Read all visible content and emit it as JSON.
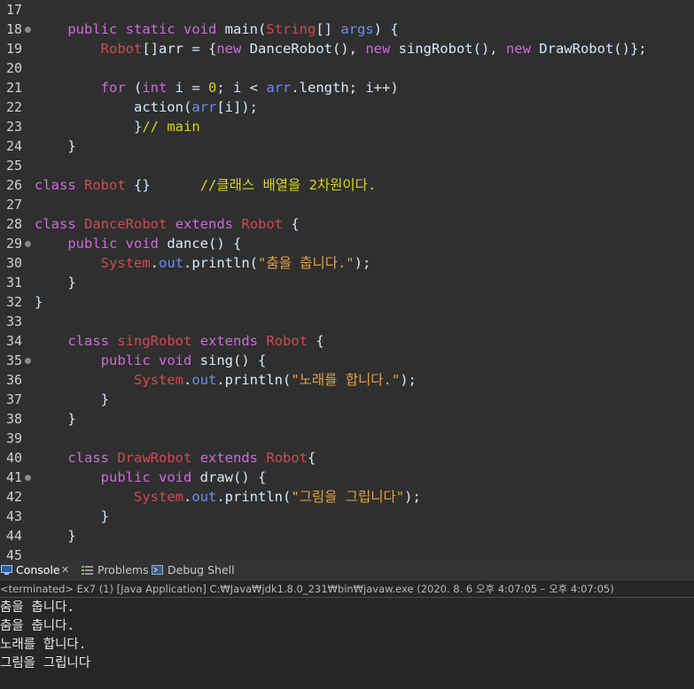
{
  "editor": {
    "lines": [
      {
        "num": "17",
        "fold": false,
        "tokens": []
      },
      {
        "num": "18",
        "fold": true,
        "tokens": [
          [
            "d",
            "    "
          ],
          [
            "k",
            "public"
          ],
          [
            "d",
            " "
          ],
          [
            "k",
            "static"
          ],
          [
            "d",
            " "
          ],
          [
            "k",
            "void"
          ],
          [
            "d",
            " main("
          ],
          [
            "t",
            "String"
          ],
          [
            "d",
            "[] "
          ],
          [
            "n",
            "args"
          ],
          [
            "d",
            ") {"
          ]
        ]
      },
      {
        "num": "19",
        "fold": false,
        "tokens": [
          [
            "d",
            "        "
          ],
          [
            "t",
            "Robot"
          ],
          [
            "d",
            "[]arr = {"
          ],
          [
            "k",
            "new"
          ],
          [
            "d",
            " DanceRobot(), "
          ],
          [
            "k",
            "new"
          ],
          [
            "d",
            " singRobot(), "
          ],
          [
            "k",
            "new"
          ],
          [
            "d",
            " DrawRobot()};"
          ]
        ]
      },
      {
        "num": "20",
        "fold": false,
        "tokens": []
      },
      {
        "num": "21",
        "fold": false,
        "tokens": [
          [
            "d",
            "        "
          ],
          [
            "k",
            "for"
          ],
          [
            "d",
            " ("
          ],
          [
            "k",
            "int"
          ],
          [
            "d",
            " i = "
          ],
          [
            "c",
            "0"
          ],
          [
            "d",
            "; i < "
          ],
          [
            "n",
            "arr"
          ],
          [
            "d",
            ".length; i++)"
          ]
        ]
      },
      {
        "num": "22",
        "fold": false,
        "tokens": [
          [
            "d",
            "            action("
          ],
          [
            "n",
            "arr"
          ],
          [
            "d",
            "[i]);"
          ]
        ]
      },
      {
        "num": "23",
        "fold": false,
        "tokens": [
          [
            "d",
            "            }"
          ],
          [
            "c",
            "// main"
          ]
        ]
      },
      {
        "num": "24",
        "fold": false,
        "tokens": [
          [
            "d",
            "    }"
          ]
        ]
      },
      {
        "num": "25",
        "fold": false,
        "tokens": []
      },
      {
        "num": "26",
        "fold": false,
        "tokens": [
          [
            "k",
            "class"
          ],
          [
            "d",
            " "
          ],
          [
            "t",
            "Robot"
          ],
          [
            "d",
            " {}      "
          ],
          [
            "c",
            "//클래스 배열을 2차원이다."
          ]
        ]
      },
      {
        "num": "27",
        "fold": false,
        "tokens": []
      },
      {
        "num": "28",
        "fold": false,
        "tokens": [
          [
            "k",
            "class"
          ],
          [
            "d",
            " "
          ],
          [
            "t",
            "DanceRobot"
          ],
          [
            "d",
            " "
          ],
          [
            "k",
            "extends"
          ],
          [
            "d",
            " "
          ],
          [
            "t",
            "Robot"
          ],
          [
            "d",
            " {"
          ]
        ]
      },
      {
        "num": "29",
        "fold": true,
        "tokens": [
          [
            "d",
            "    "
          ],
          [
            "k",
            "public"
          ],
          [
            "d",
            " "
          ],
          [
            "k",
            "void"
          ],
          [
            "d",
            " dance() {"
          ]
        ]
      },
      {
        "num": "30",
        "fold": false,
        "tokens": [
          [
            "d",
            "        "
          ],
          [
            "t",
            "System"
          ],
          [
            "d",
            "."
          ],
          [
            "n",
            "out"
          ],
          [
            "d",
            ".println("
          ],
          [
            "s",
            "\"춤을 춥니다.\""
          ],
          [
            "d",
            ");"
          ]
        ]
      },
      {
        "num": "31",
        "fold": false,
        "tokens": [
          [
            "d",
            "    }"
          ]
        ]
      },
      {
        "num": "32",
        "fold": false,
        "tokens": [
          [
            "d",
            "}"
          ]
        ]
      },
      {
        "num": "33",
        "fold": false,
        "tokens": []
      },
      {
        "num": "34",
        "fold": false,
        "tokens": [
          [
            "d",
            "    "
          ],
          [
            "k",
            "class"
          ],
          [
            "d",
            " "
          ],
          [
            "t",
            "singRobot"
          ],
          [
            "d",
            " "
          ],
          [
            "k",
            "extends"
          ],
          [
            "d",
            " "
          ],
          [
            "t",
            "Robot"
          ],
          [
            "d",
            " {"
          ]
        ]
      },
      {
        "num": "35",
        "fold": true,
        "tokens": [
          [
            "d",
            "        "
          ],
          [
            "k",
            "public"
          ],
          [
            "d",
            " "
          ],
          [
            "k",
            "void"
          ],
          [
            "d",
            " sing() {"
          ]
        ]
      },
      {
        "num": "36",
        "fold": false,
        "tokens": [
          [
            "d",
            "            "
          ],
          [
            "t",
            "System"
          ],
          [
            "d",
            "."
          ],
          [
            "n",
            "out"
          ],
          [
            "d",
            ".println("
          ],
          [
            "s",
            "\"노래를 합니다.\""
          ],
          [
            "d",
            ");"
          ]
        ]
      },
      {
        "num": "37",
        "fold": false,
        "tokens": [
          [
            "d",
            "        }"
          ]
        ]
      },
      {
        "num": "38",
        "fold": false,
        "tokens": [
          [
            "d",
            "    }"
          ]
        ]
      },
      {
        "num": "39",
        "fold": false,
        "tokens": []
      },
      {
        "num": "40",
        "fold": false,
        "tokens": [
          [
            "d",
            "    "
          ],
          [
            "k",
            "class"
          ],
          [
            "d",
            " "
          ],
          [
            "t",
            "DrawRobot"
          ],
          [
            "d",
            " "
          ],
          [
            "k",
            "extends"
          ],
          [
            "d",
            " "
          ],
          [
            "t",
            "Robot"
          ],
          [
            "d",
            "{"
          ]
        ]
      },
      {
        "num": "41",
        "fold": true,
        "tokens": [
          [
            "d",
            "        "
          ],
          [
            "k",
            "public"
          ],
          [
            "d",
            " "
          ],
          [
            "k",
            "void"
          ],
          [
            "d",
            " draw() {"
          ]
        ]
      },
      {
        "num": "42",
        "fold": false,
        "tokens": [
          [
            "d",
            "            "
          ],
          [
            "t",
            "System"
          ],
          [
            "d",
            "."
          ],
          [
            "n",
            "out"
          ],
          [
            "d",
            ".println("
          ],
          [
            "s",
            "\"그림을 그립니다\""
          ],
          [
            "d",
            ");"
          ]
        ]
      },
      {
        "num": "43",
        "fold": false,
        "tokens": [
          [
            "d",
            "        }"
          ]
        ]
      },
      {
        "num": "44",
        "fold": false,
        "tokens": [
          [
            "d",
            "    }"
          ]
        ]
      },
      {
        "num": "45",
        "fold": false,
        "tokens": []
      }
    ]
  },
  "console": {
    "tabs": [
      {
        "label": "Console",
        "close": "✕",
        "icon": "console-icon",
        "active": true
      },
      {
        "label": "Problems",
        "icon": "problems-icon",
        "active": false
      },
      {
        "label": "Debug Shell",
        "icon": "debug-shell-icon",
        "active": false
      }
    ],
    "status": "<terminated> Ex7 (1) [Java Application] C:₩Java₩jdk1.8.0_231₩bin₩javaw.exe  (2020. 8. 6 오후 4:07:05 – 오후 4:07:05)",
    "output": [
      "춤을 춥니다.",
      "춤을 춥니다.",
      "노래를 합니다.",
      "그림을 그립니다"
    ]
  },
  "colors": {
    "keyword": "#cc6cd9",
    "type": "#cf4a52",
    "string": "#e8a040",
    "comment": "#d6d61e",
    "field": "#6b8ef0",
    "default": "#d9e8f7"
  }
}
